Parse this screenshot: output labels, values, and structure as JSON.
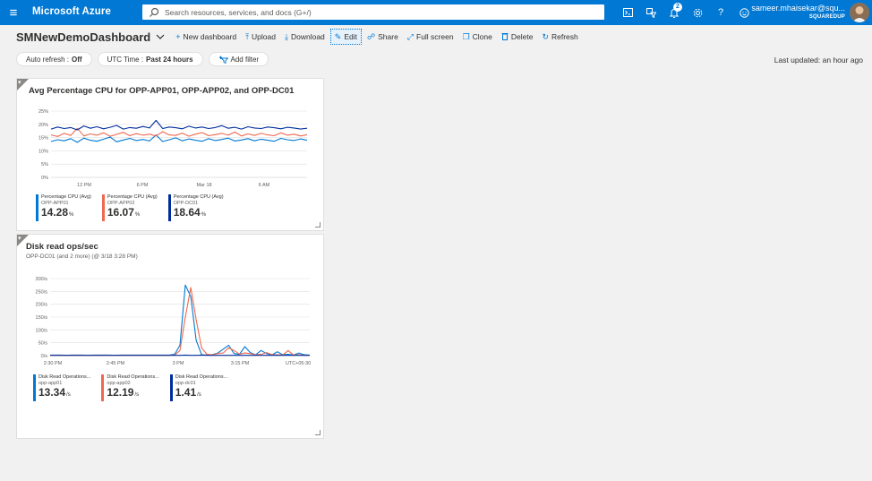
{
  "topbar": {
    "brand": "Microsoft Azure",
    "search_placeholder": "Search resources, services, and docs (G+/)",
    "notification_count": "2",
    "user_name": "sameer.mhaisekar@squ...",
    "user_org": "SQUAREDUP",
    "icons": [
      "terminal-icon",
      "directory-filter-icon",
      "bell-icon",
      "gear-icon",
      "help-icon",
      "feedback-icon"
    ]
  },
  "commandbar": {
    "title": "SMNewDemoDashboard",
    "commands": [
      {
        "name": "new-dashboard",
        "icon": "+",
        "label": "New dashboard"
      },
      {
        "name": "upload",
        "icon": "⤒",
        "label": "Upload"
      },
      {
        "name": "download",
        "icon": "⤓",
        "label": "Download"
      },
      {
        "name": "edit",
        "icon": "✎",
        "label": "Edit"
      },
      {
        "name": "share",
        "icon": "☍",
        "label": "Share"
      },
      {
        "name": "full-screen",
        "icon": "⤢",
        "label": "Full screen"
      },
      {
        "name": "clone",
        "icon": "❐",
        "label": "Clone"
      },
      {
        "name": "delete",
        "icon": "🗑",
        "label": "Delete"
      },
      {
        "name": "refresh",
        "icon": "↻",
        "label": "Refresh"
      }
    ]
  },
  "filters": {
    "auto_refresh_label": "Auto refresh :",
    "auto_refresh_value": "Off",
    "time_label": "UTC Time :",
    "time_value": "Past 24 hours",
    "add_filter": "Add filter",
    "last_updated": "Last updated: an hour ago"
  },
  "colors": {
    "series1": "#0078d4",
    "series2": "#ef6950",
    "series3": "#002d9c"
  },
  "tiles": [
    {
      "title": "Avg Percentage CPU for OPP-APP01, OPP-APP02, and OPP-DC01",
      "legend": [
        {
          "name": "Percentage CPU (Avg)",
          "sub": "OPP-APP01",
          "value": "14.28",
          "unit": "%"
        },
        {
          "name": "Percentage CPU (Avg)",
          "sub": "OPP-APP02",
          "value": "16.07",
          "unit": "%"
        },
        {
          "name": "Percentage CPU (Avg)",
          "sub": "OPP-DC01",
          "value": "18.64",
          "unit": "%"
        }
      ]
    },
    {
      "title": "Disk read ops/sec",
      "subtitle": "OPP-DC01 (and 2 more) (@ 3/18 3:28 PM)",
      "legend": [
        {
          "name": "Disk Read Operations...",
          "sub": "opp-app01",
          "value": "13.34",
          "unit": "/s"
        },
        {
          "name": "Disk Read Operations...",
          "sub": "opp-app02",
          "value": "12.19",
          "unit": "/s"
        },
        {
          "name": "Disk Read Operations...",
          "sub": "opp-dc01",
          "value": "1.41",
          "unit": "/s"
        }
      ]
    }
  ],
  "chart_data": [
    {
      "type": "line",
      "title": "Avg Percentage CPU for OPP-APP01, OPP-APP02, and OPP-DC01",
      "yticks": [
        "25%",
        "20%",
        "15%",
        "10%",
        "5%",
        "0%"
      ],
      "ylim": [
        0,
        25
      ],
      "xticks": [
        "12 PM",
        "6 PM",
        "Mar 18",
        "6 AM"
      ],
      "grid": true,
      "series": [
        {
          "name": "OPP-APP01",
          "values": [
            13.5,
            14.2,
            13.8,
            14.6,
            13.2,
            14.8,
            14.0,
            13.6,
            14.4,
            15.2,
            13.4,
            14.1,
            14.7,
            13.9,
            14.3,
            13.7,
            16.0,
            13.5,
            14.2,
            14.9,
            13.8,
            14.5,
            14.0,
            13.6,
            14.6,
            13.9,
            14.3,
            14.8,
            13.7,
            14.1,
            14.6,
            13.8,
            14.4,
            14.0,
            13.6,
            14.7,
            14.2,
            13.9,
            14.5,
            14.0
          ]
        },
        {
          "name": "OPP-APP02",
          "values": [
            16.0,
            15.4,
            16.6,
            15.8,
            18.5,
            15.6,
            16.4,
            15.9,
            16.8,
            15.5,
            16.2,
            17.0,
            15.7,
            16.5,
            15.9,
            16.3,
            15.6,
            17.2,
            16.0,
            15.8,
            16.7,
            15.5,
            16.3,
            16.9,
            15.7,
            16.1,
            16.6,
            15.9,
            17.1,
            15.6,
            16.4,
            15.8,
            16.6,
            16.0,
            15.7,
            16.8,
            15.9,
            16.3,
            15.6,
            16.1
          ]
        },
        {
          "name": "OPP-DC01",
          "values": [
            18.2,
            19.0,
            18.4,
            18.8,
            17.9,
            19.4,
            18.5,
            19.1,
            18.3,
            18.9,
            19.6,
            18.2,
            18.8,
            18.5,
            19.2,
            18.6,
            21.5,
            18.4,
            19.0,
            18.7,
            18.3,
            19.3,
            18.6,
            19.0,
            18.4,
            18.8,
            19.5,
            18.5,
            18.9,
            18.2,
            19.1,
            18.6,
            18.4,
            19.0,
            18.7,
            18.3,
            18.9,
            18.6,
            18.2,
            18.5
          ]
        }
      ]
    },
    {
      "type": "line",
      "title": "Disk read ops/sec",
      "yticks": [
        "300/s",
        "250/s",
        "200/s",
        "150/s",
        "100/s",
        "50/s",
        "0/s"
      ],
      "ylim": [
        0,
        300
      ],
      "xticks": [
        "2:30 PM",
        "2:45 PM",
        "3 PM",
        "3:15 PM",
        "UTC+05:30"
      ],
      "grid": true,
      "series": [
        {
          "name": "opp-app01",
          "values": [
            2,
            2,
            2,
            1,
            2,
            2,
            2,
            1,
            2,
            2,
            2,
            2,
            1,
            2,
            2,
            2,
            2,
            2,
            2,
            2,
            2,
            2,
            2,
            5,
            40,
            275,
            230,
            60,
            3,
            2,
            4,
            10,
            25,
            40,
            8,
            5,
            35,
            12,
            3,
            20,
            8,
            2,
            15,
            3,
            5,
            2,
            10,
            3,
            2
          ]
        },
        {
          "name": "opp-app02",
          "values": [
            1,
            1,
            1,
            1,
            1,
            1,
            1,
            1,
            1,
            1,
            1,
            1,
            1,
            1,
            1,
            1,
            1,
            1,
            1,
            1,
            1,
            1,
            1,
            2,
            20,
            150,
            265,
            140,
            30,
            5,
            3,
            8,
            10,
            30,
            20,
            6,
            10,
            8,
            3,
            5,
            12,
            4,
            3,
            2,
            20,
            2,
            3,
            1,
            1
          ]
        },
        {
          "name": "opp-dc01",
          "values": [
            1,
            1,
            1,
            1,
            1,
            1,
            1,
            1,
            1,
            1,
            1,
            1,
            1,
            1,
            1,
            1,
            1,
            1,
            1,
            1,
            1,
            1,
            1,
            1,
            1,
            2,
            1,
            1,
            2,
            1,
            1,
            1,
            1,
            1,
            1,
            1,
            1,
            1,
            1,
            1,
            1,
            1,
            1,
            1,
            1,
            1,
            1,
            1,
            1
          ]
        }
      ]
    }
  ]
}
